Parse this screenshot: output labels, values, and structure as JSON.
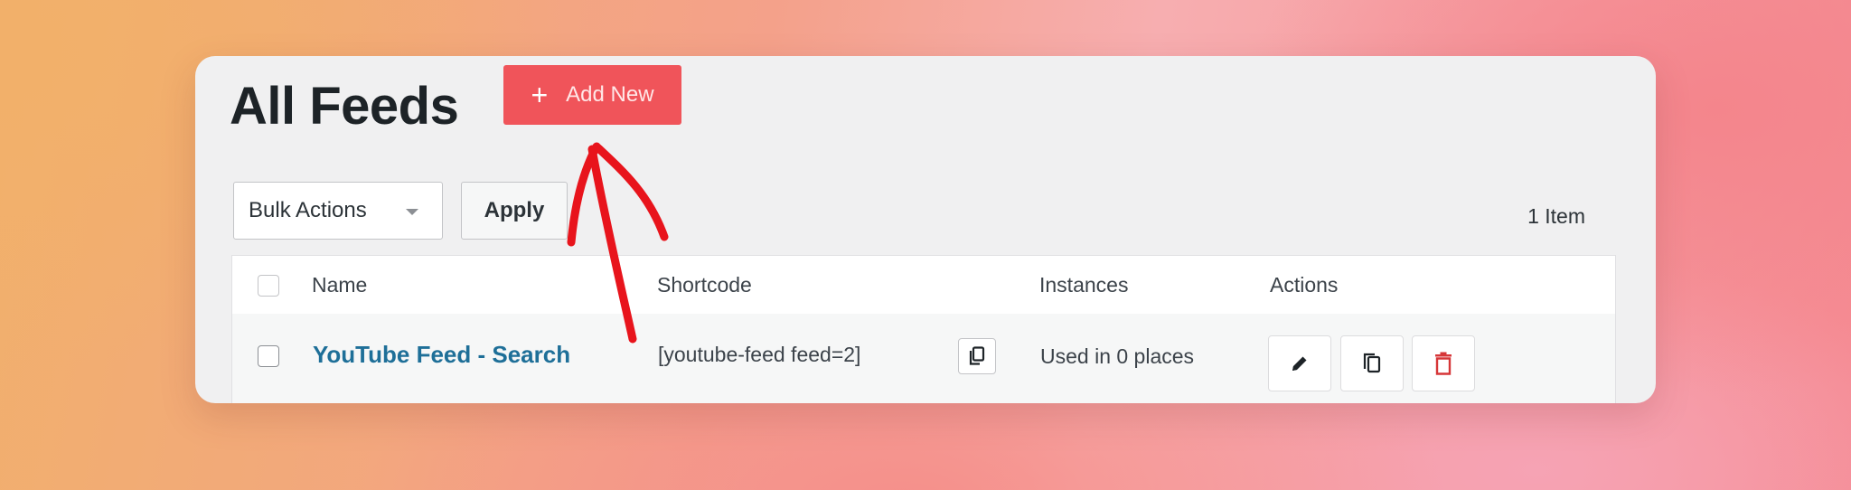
{
  "page": {
    "title": "All Feeds",
    "add_new_label": "Add New"
  },
  "toolbar": {
    "bulk_actions_value": "Bulk Actions",
    "apply_label": "Apply",
    "item_count": "1 Item"
  },
  "table": {
    "columns": [
      "Name",
      "Shortcode",
      "Instances",
      "Actions"
    ],
    "rows": [
      {
        "name": "YouTube Feed - Search",
        "shortcode": "[youtube-feed feed=2]",
        "instances": "Used in 0 places"
      }
    ]
  },
  "icons": {
    "add": "plus-icon",
    "dropdown": "caret-down-icon",
    "copy_shortcode": "copy-icon",
    "edit": "pencil-icon",
    "duplicate": "duplicate-icon",
    "delete": "trash-icon"
  },
  "colors": {
    "accent": "#f0545a",
    "link": "#1e6f98",
    "danger": "#d63638",
    "annotation": "#e8141c"
  }
}
